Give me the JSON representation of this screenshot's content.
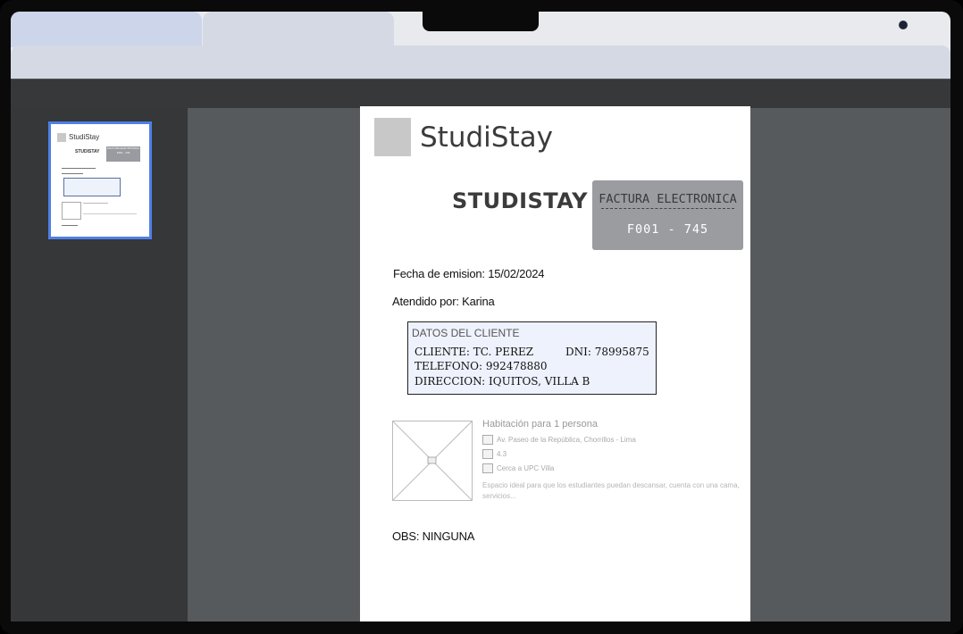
{
  "sidebar": {
    "thumbnail": {
      "brand": "StudiStay",
      "company": "STUDISTAY",
      "invoice_title": "FACTURA ELECTRONICA",
      "invoice_number": "F001 - 745"
    }
  },
  "document": {
    "brand": "StudiStay",
    "company": "STUDISTAY",
    "invoice": {
      "title": "FACTURA ELECTRONICA",
      "dashes": "-------------------",
      "number": "F001 - 745"
    },
    "issue_date": "Fecha de emision: 15/02/2024",
    "attended_by": "Atendido por: Karina",
    "client": {
      "header": "DATOS DEL CLIENTE",
      "name": "CLIENTE: TC. PEREZ",
      "dni": "DNI: 78995875",
      "phone": "TELEFONO: 992478880",
      "address": "DIRECCION: IQUITOS, VILLA B"
    },
    "listing": {
      "title": "Habitación para 1 persona",
      "address": "Av. Paseo de la República, Chorrillos - Lima",
      "rating": "4.3",
      "nearby": "Cerca a UPC Villa",
      "description": "Espacio ideal para que los estudiantes puedan descansar, cuenta con una cama, servicios..."
    },
    "observations": "OBS: NINGUNA"
  },
  "colors": {
    "thumbnail_border": "#4f7fe6",
    "invoice_box": "#9a9ca0",
    "client_box_bg": "#eef2fd",
    "viewer_bg": "#575a5c",
    "sidebar_bg": "#353739"
  }
}
